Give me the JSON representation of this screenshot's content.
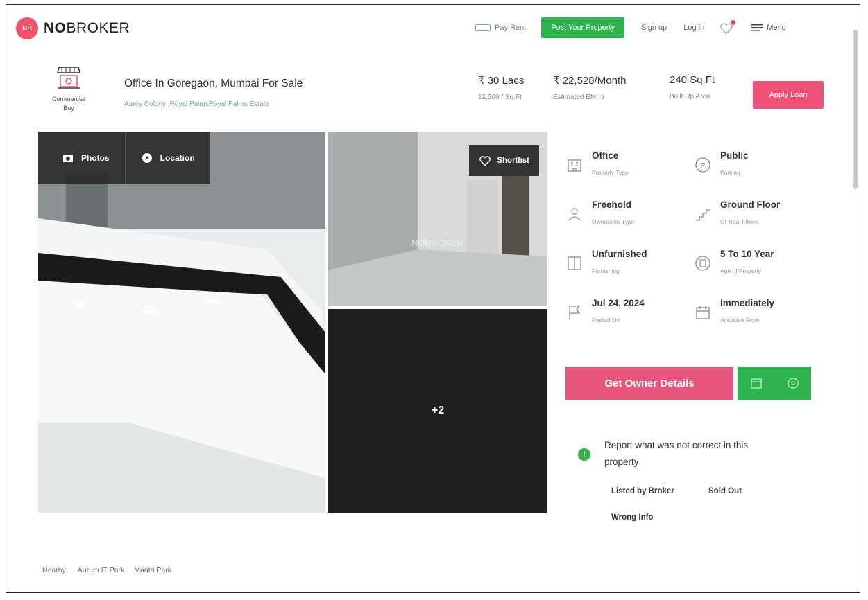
{
  "brand": {
    "logo_bold": "NO",
    "logo_rest": "BROKER",
    "mark": "NB"
  },
  "nav": {
    "pay_rent": "Pay Rent",
    "post_property": "Post Your Property",
    "sign_up": "Sign up",
    "log_in": "Log in",
    "menu": "Menu"
  },
  "category": {
    "line1": "Commercial",
    "line2": "Buy"
  },
  "property": {
    "title": "Office In Goregaon, Mumbai For Sale",
    "subtitle": "Aarey Colony ,Royal PalmsRoyal Palms Estate"
  },
  "figures": [
    {
      "value": "₹ 30 Lacs",
      "label": "12,500 / Sq.Ft"
    },
    {
      "value": "₹ 22,528/Month",
      "label": "Estimated EMI ∨"
    },
    {
      "value": "240 Sq.Ft",
      "label": "Built Up Area"
    }
  ],
  "apply_loan": "Apply Loan",
  "gallery": {
    "photos_tab": "Photos",
    "location_tab": "Location",
    "shortlist": "Shortlist",
    "more_count": "+2"
  },
  "details": [
    {
      "value": "Office",
      "label": "Property Type",
      "icon": "building-icon"
    },
    {
      "value": "Public",
      "label": "Parking",
      "icon": "parking-icon"
    },
    {
      "value": "Freehold",
      "label": "Ownership Type",
      "icon": "owner-icon"
    },
    {
      "value": "Ground Floor",
      "label": "Of Total Floors",
      "icon": "stairs-icon"
    },
    {
      "value": "Unfurnished",
      "label": "Furnishing",
      "icon": "furnishing-icon"
    },
    {
      "value": "5 To 10 Year",
      "label": "Age of Property",
      "icon": "age-icon"
    },
    {
      "value": "Jul 24, 2024",
      "label": "Posted On",
      "icon": "flag-icon"
    },
    {
      "value": "Immediately",
      "label": "Available From",
      "icon": "calendar-icon"
    }
  ],
  "owner": {
    "button": "Get Owner Details"
  },
  "report": {
    "title": "Report what was not correct in this property",
    "listed_by_broker": "Listed by Broker",
    "sold_out": "Sold Out",
    "wrong_info": "Wrong Info"
  },
  "nearby": {
    "label": "Nearby:",
    "places": [
      "Aurum IT Park",
      "Mantri Park"
    ]
  },
  "colors": {
    "brand_pink": "#f0516b",
    "green": "#2fb34f",
    "cta_pink": "#e8557c"
  }
}
